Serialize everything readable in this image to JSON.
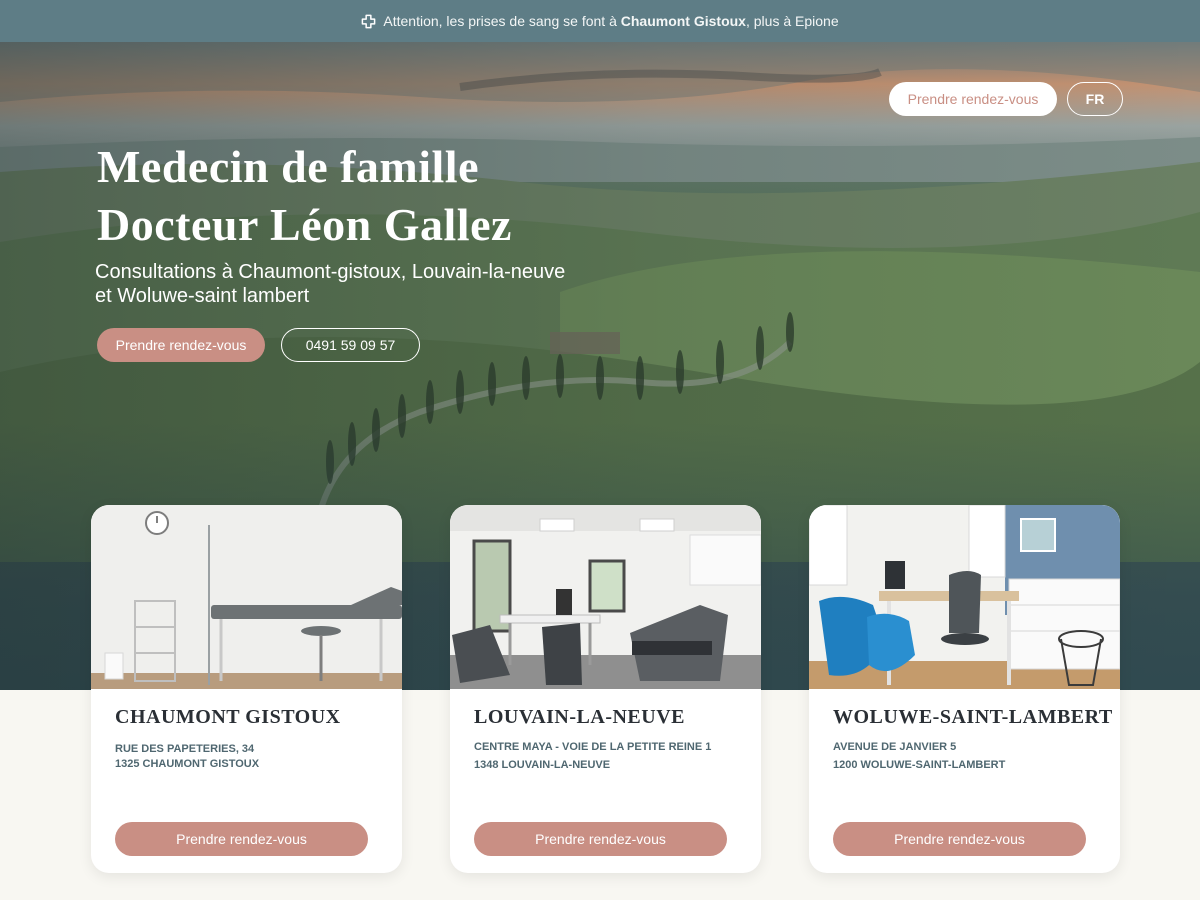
{
  "topbar": {
    "prefix": "Attention, les prises de sang se font à",
    "highlight": "Chaumont Gistoux",
    "suffix": ", plus à Epione",
    "icon": "medical-cross-icon"
  },
  "nav": {
    "cta_label": "Prendre rendez-vous",
    "lang": "FR"
  },
  "hero": {
    "title_line1": "Medecin de famille",
    "title_line2": "Docteur Léon Gallez",
    "subtitle": "Consultations à Chaumont-gistoux, Louvain-la-neuve  et Woluwe-saint lambert",
    "cta_label": "Prendre rendez-vous",
    "phone": "0491 59 09 57"
  },
  "locations": [
    {
      "city": "CHAUMONT GISTOUX",
      "address_line1": "RUE DES PAPETERIES, 34",
      "address_line2": "1325 CHAUMONT GISTOUX",
      "cta_label": "Prendre rendez-vous"
    },
    {
      "city": "LOUVAIN-LA-NEUVE",
      "address_line1": "CENTRE MAYA - VOIE DE LA PETITE REINE 1",
      "address_line2": "1348 LOUVAIN-LA-NEUVE",
      "cta_label": "Prendre rendez-vous"
    },
    {
      "city": "WOLUWE-SAINT-LAMBERT",
      "address_line1": "AVENUE DE JANVIER 5",
      "address_line2": "1200 WOLUWE-SAINT-LAMBERT",
      "cta_label": "Prendre rendez-vous"
    }
  ],
  "colors": {
    "accent": "#c98f84",
    "topbar": "#5e7d86",
    "heading": "#2a2f35",
    "address": "#4f6770",
    "page_bg": "#f8f7f2"
  }
}
